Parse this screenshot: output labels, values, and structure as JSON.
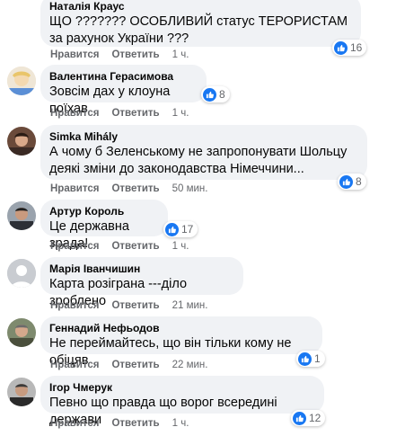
{
  "actions": {
    "like": "Нравится",
    "reply": "Ответить"
  },
  "comments": [
    {
      "author": "Наталія Краус",
      "text": "ЩО ??????? ОСОБЛИВИЙ статус ТЕРОРИСТАМ за рахунок України ???",
      "time": "1 ч.",
      "likes": "16"
    },
    {
      "author": "Валентина Герасимова",
      "text": "Зовсім дах у клоуна поїхав",
      "time": "1 ч.",
      "likes": "8"
    },
    {
      "author": "Simka Mihály",
      "text": "А чому б Зеленському не запропонувати Шольцу деякі зміни до законодавства Німеччини...",
      "time": "50 мин.",
      "likes": "8"
    },
    {
      "author": "Артур Король",
      "text": "Це державна зрада!",
      "time": "1 ч.",
      "likes": "17"
    },
    {
      "author": "Марія Іванчишин",
      "text": "Карта розіграна ---діло зроблено",
      "time": "21 мин.",
      "likes": ""
    },
    {
      "author": "Геннадий Нефьодов",
      "text": "Не переймайтесь, що він тільки кому не обіцяв",
      "time": "22 мин.",
      "likes": "1"
    },
    {
      "author": "Ігор Чмерук",
      "text": "Певно що правда що ворог всередині держави",
      "time": "1 ч.",
      "likes": "12"
    }
  ],
  "colors": {
    "bubble": "#f0f2f5",
    "like_blue": "#1877f2",
    "meta_gray": "#65676b"
  },
  "icons": {
    "reaction": "thumbs-up-icon"
  }
}
